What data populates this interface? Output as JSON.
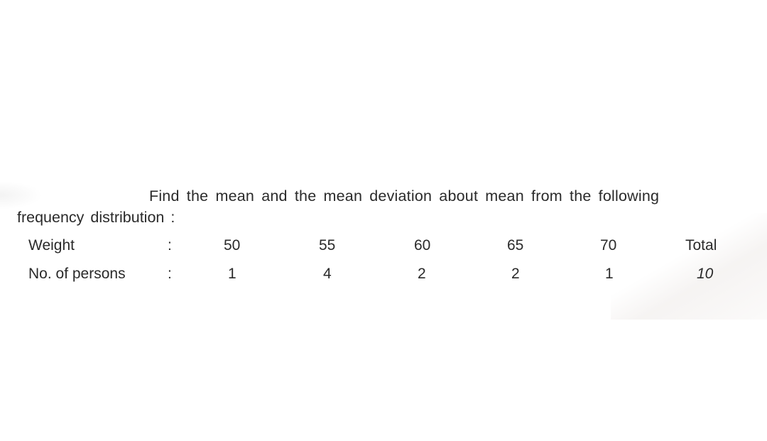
{
  "problem": {
    "intro_line1": "Find the mean and the mean deviation about mean from the following",
    "intro_line2": "frequency distribution :"
  },
  "table": {
    "rows": [
      {
        "label": "Weight",
        "separator": ":",
        "values": [
          "50",
          "55",
          "60",
          "65",
          "70",
          "Total"
        ]
      },
      {
        "label": "No. of persons",
        "separator": ":",
        "values": [
          "1",
          "4",
          "2",
          "2",
          "1",
          "10"
        ]
      }
    ]
  }
}
